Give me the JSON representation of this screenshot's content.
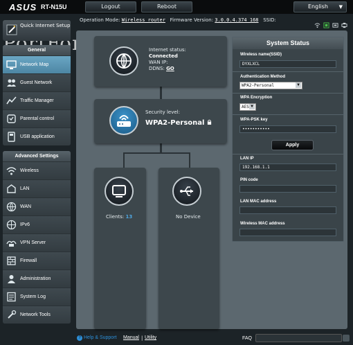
{
  "header": {
    "brand": "ASUS",
    "model": "RT-N15U",
    "logout_label": "Logout",
    "reboot_label": "Reboot",
    "language": "English"
  },
  "status_line": {
    "op_mode_label": "Operation Mode:",
    "op_mode_value": "Wireless router",
    "firmware_label": "Firmware Version:",
    "firmware_value": "3.0.0.4.374_168",
    "ssid_label": "SSID:"
  },
  "watermark": "PortForward.com",
  "sidebar": {
    "quick_setup": "Quick Internet Setup",
    "general_header": "General",
    "general_items": [
      {
        "label": "Network Map",
        "icon": "network-map-icon"
      },
      {
        "label": "Guest Network",
        "icon": "guest-network-icon"
      },
      {
        "label": "Traffic Manager",
        "icon": "traffic-manager-icon"
      },
      {
        "label": "Parental control",
        "icon": "parental-control-icon"
      },
      {
        "label": "USB application",
        "icon": "usb-application-icon"
      }
    ],
    "advanced_header": "Advanced Settings",
    "advanced_items": [
      {
        "label": "Wireless",
        "icon": "wireless-icon"
      },
      {
        "label": "LAN",
        "icon": "lan-icon"
      },
      {
        "label": "WAN",
        "icon": "wan-icon"
      },
      {
        "label": "IPv6",
        "icon": "ipv6-icon"
      },
      {
        "label": "VPN Server",
        "icon": "vpn-server-icon"
      },
      {
        "label": "Firewall",
        "icon": "firewall-icon"
      },
      {
        "label": "Administration",
        "icon": "administration-icon"
      },
      {
        "label": "System Log",
        "icon": "system-log-icon"
      },
      {
        "label": "Network Tools",
        "icon": "network-tools-icon"
      }
    ]
  },
  "map": {
    "internet_status_label": "Internet status:",
    "internet_status_value": "Connected",
    "wan_ip_label": "WAN IP:",
    "ddns_label": "DDNS:",
    "ddns_link": "GO",
    "security_label": "Security level:",
    "security_value": "WPA2-Personal",
    "clients_label": "Clients:",
    "clients_count": "13",
    "usb_label": "No Device"
  },
  "system_status": {
    "title": "System Status",
    "ssid_label": "Wireless name(SSID)",
    "ssid_value": "DYXLXCL",
    "auth_label": "Authentication Method",
    "auth_value": "WPA2-Personal",
    "enc_label": "WPA Encryption",
    "enc_value": "AES",
    "psk_label": "WPA-PSK key",
    "psk_value": "•••••••••••",
    "apply_label": "Apply",
    "lan_ip_label": "LAN IP",
    "lan_ip_value": "192.168.1.1",
    "pin_label": "PIN code",
    "pin_value": "",
    "lan_mac_label": "LAN MAC address",
    "lan_mac_value": "",
    "wireless_mac_label": "Wireless MAC address",
    "wireless_mac_value": ""
  },
  "footer": {
    "help_label": "Help & Support",
    "manual_label": "Manual",
    "separator": "|",
    "utility_label": "Utility",
    "faq_label": "FAQ"
  },
  "colors": {
    "accent_blue": "#2d8fd8",
    "active_item": "#5b96b4",
    "panel_bg": "#5c686f"
  }
}
